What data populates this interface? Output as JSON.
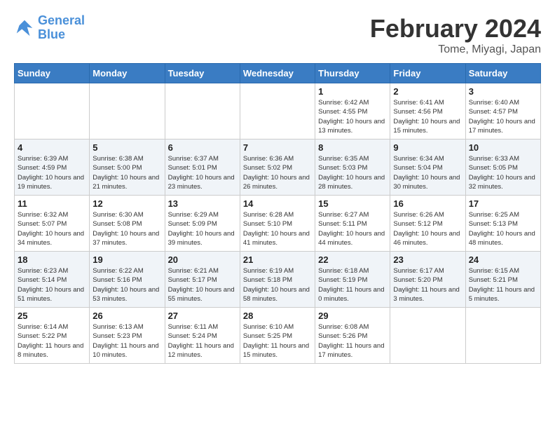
{
  "logo": {
    "line1": "General",
    "line2": "Blue"
  },
  "title": "February 2024",
  "location": "Tome, Miyagi, Japan",
  "days_of_week": [
    "Sunday",
    "Monday",
    "Tuesday",
    "Wednesday",
    "Thursday",
    "Friday",
    "Saturday"
  ],
  "weeks": [
    [
      {
        "day": "",
        "info": ""
      },
      {
        "day": "",
        "info": ""
      },
      {
        "day": "",
        "info": ""
      },
      {
        "day": "",
        "info": ""
      },
      {
        "day": "1",
        "info": "Sunrise: 6:42 AM\nSunset: 4:55 PM\nDaylight: 10 hours\nand 13 minutes."
      },
      {
        "day": "2",
        "info": "Sunrise: 6:41 AM\nSunset: 4:56 PM\nDaylight: 10 hours\nand 15 minutes."
      },
      {
        "day": "3",
        "info": "Sunrise: 6:40 AM\nSunset: 4:57 PM\nDaylight: 10 hours\nand 17 minutes."
      }
    ],
    [
      {
        "day": "4",
        "info": "Sunrise: 6:39 AM\nSunset: 4:59 PM\nDaylight: 10 hours\nand 19 minutes."
      },
      {
        "day": "5",
        "info": "Sunrise: 6:38 AM\nSunset: 5:00 PM\nDaylight: 10 hours\nand 21 minutes."
      },
      {
        "day": "6",
        "info": "Sunrise: 6:37 AM\nSunset: 5:01 PM\nDaylight: 10 hours\nand 23 minutes."
      },
      {
        "day": "7",
        "info": "Sunrise: 6:36 AM\nSunset: 5:02 PM\nDaylight: 10 hours\nand 26 minutes."
      },
      {
        "day": "8",
        "info": "Sunrise: 6:35 AM\nSunset: 5:03 PM\nDaylight: 10 hours\nand 28 minutes."
      },
      {
        "day": "9",
        "info": "Sunrise: 6:34 AM\nSunset: 5:04 PM\nDaylight: 10 hours\nand 30 minutes."
      },
      {
        "day": "10",
        "info": "Sunrise: 6:33 AM\nSunset: 5:05 PM\nDaylight: 10 hours\nand 32 minutes."
      }
    ],
    [
      {
        "day": "11",
        "info": "Sunrise: 6:32 AM\nSunset: 5:07 PM\nDaylight: 10 hours\nand 34 minutes."
      },
      {
        "day": "12",
        "info": "Sunrise: 6:30 AM\nSunset: 5:08 PM\nDaylight: 10 hours\nand 37 minutes."
      },
      {
        "day": "13",
        "info": "Sunrise: 6:29 AM\nSunset: 5:09 PM\nDaylight: 10 hours\nand 39 minutes."
      },
      {
        "day": "14",
        "info": "Sunrise: 6:28 AM\nSunset: 5:10 PM\nDaylight: 10 hours\nand 41 minutes."
      },
      {
        "day": "15",
        "info": "Sunrise: 6:27 AM\nSunset: 5:11 PM\nDaylight: 10 hours\nand 44 minutes."
      },
      {
        "day": "16",
        "info": "Sunrise: 6:26 AM\nSunset: 5:12 PM\nDaylight: 10 hours\nand 46 minutes."
      },
      {
        "day": "17",
        "info": "Sunrise: 6:25 AM\nSunset: 5:13 PM\nDaylight: 10 hours\nand 48 minutes."
      }
    ],
    [
      {
        "day": "18",
        "info": "Sunrise: 6:23 AM\nSunset: 5:14 PM\nDaylight: 10 hours\nand 51 minutes."
      },
      {
        "day": "19",
        "info": "Sunrise: 6:22 AM\nSunset: 5:16 PM\nDaylight: 10 hours\nand 53 minutes."
      },
      {
        "day": "20",
        "info": "Sunrise: 6:21 AM\nSunset: 5:17 PM\nDaylight: 10 hours\nand 55 minutes."
      },
      {
        "day": "21",
        "info": "Sunrise: 6:19 AM\nSunset: 5:18 PM\nDaylight: 10 hours\nand 58 minutes."
      },
      {
        "day": "22",
        "info": "Sunrise: 6:18 AM\nSunset: 5:19 PM\nDaylight: 11 hours\nand 0 minutes."
      },
      {
        "day": "23",
        "info": "Sunrise: 6:17 AM\nSunset: 5:20 PM\nDaylight: 11 hours\nand 3 minutes."
      },
      {
        "day": "24",
        "info": "Sunrise: 6:15 AM\nSunset: 5:21 PM\nDaylight: 11 hours\nand 5 minutes."
      }
    ],
    [
      {
        "day": "25",
        "info": "Sunrise: 6:14 AM\nSunset: 5:22 PM\nDaylight: 11 hours\nand 8 minutes."
      },
      {
        "day": "26",
        "info": "Sunrise: 6:13 AM\nSunset: 5:23 PM\nDaylight: 11 hours\nand 10 minutes."
      },
      {
        "day": "27",
        "info": "Sunrise: 6:11 AM\nSunset: 5:24 PM\nDaylight: 11 hours\nand 12 minutes."
      },
      {
        "day": "28",
        "info": "Sunrise: 6:10 AM\nSunset: 5:25 PM\nDaylight: 11 hours\nand 15 minutes."
      },
      {
        "day": "29",
        "info": "Sunrise: 6:08 AM\nSunset: 5:26 PM\nDaylight: 11 hours\nand 17 minutes."
      },
      {
        "day": "",
        "info": ""
      },
      {
        "day": "",
        "info": ""
      }
    ]
  ]
}
